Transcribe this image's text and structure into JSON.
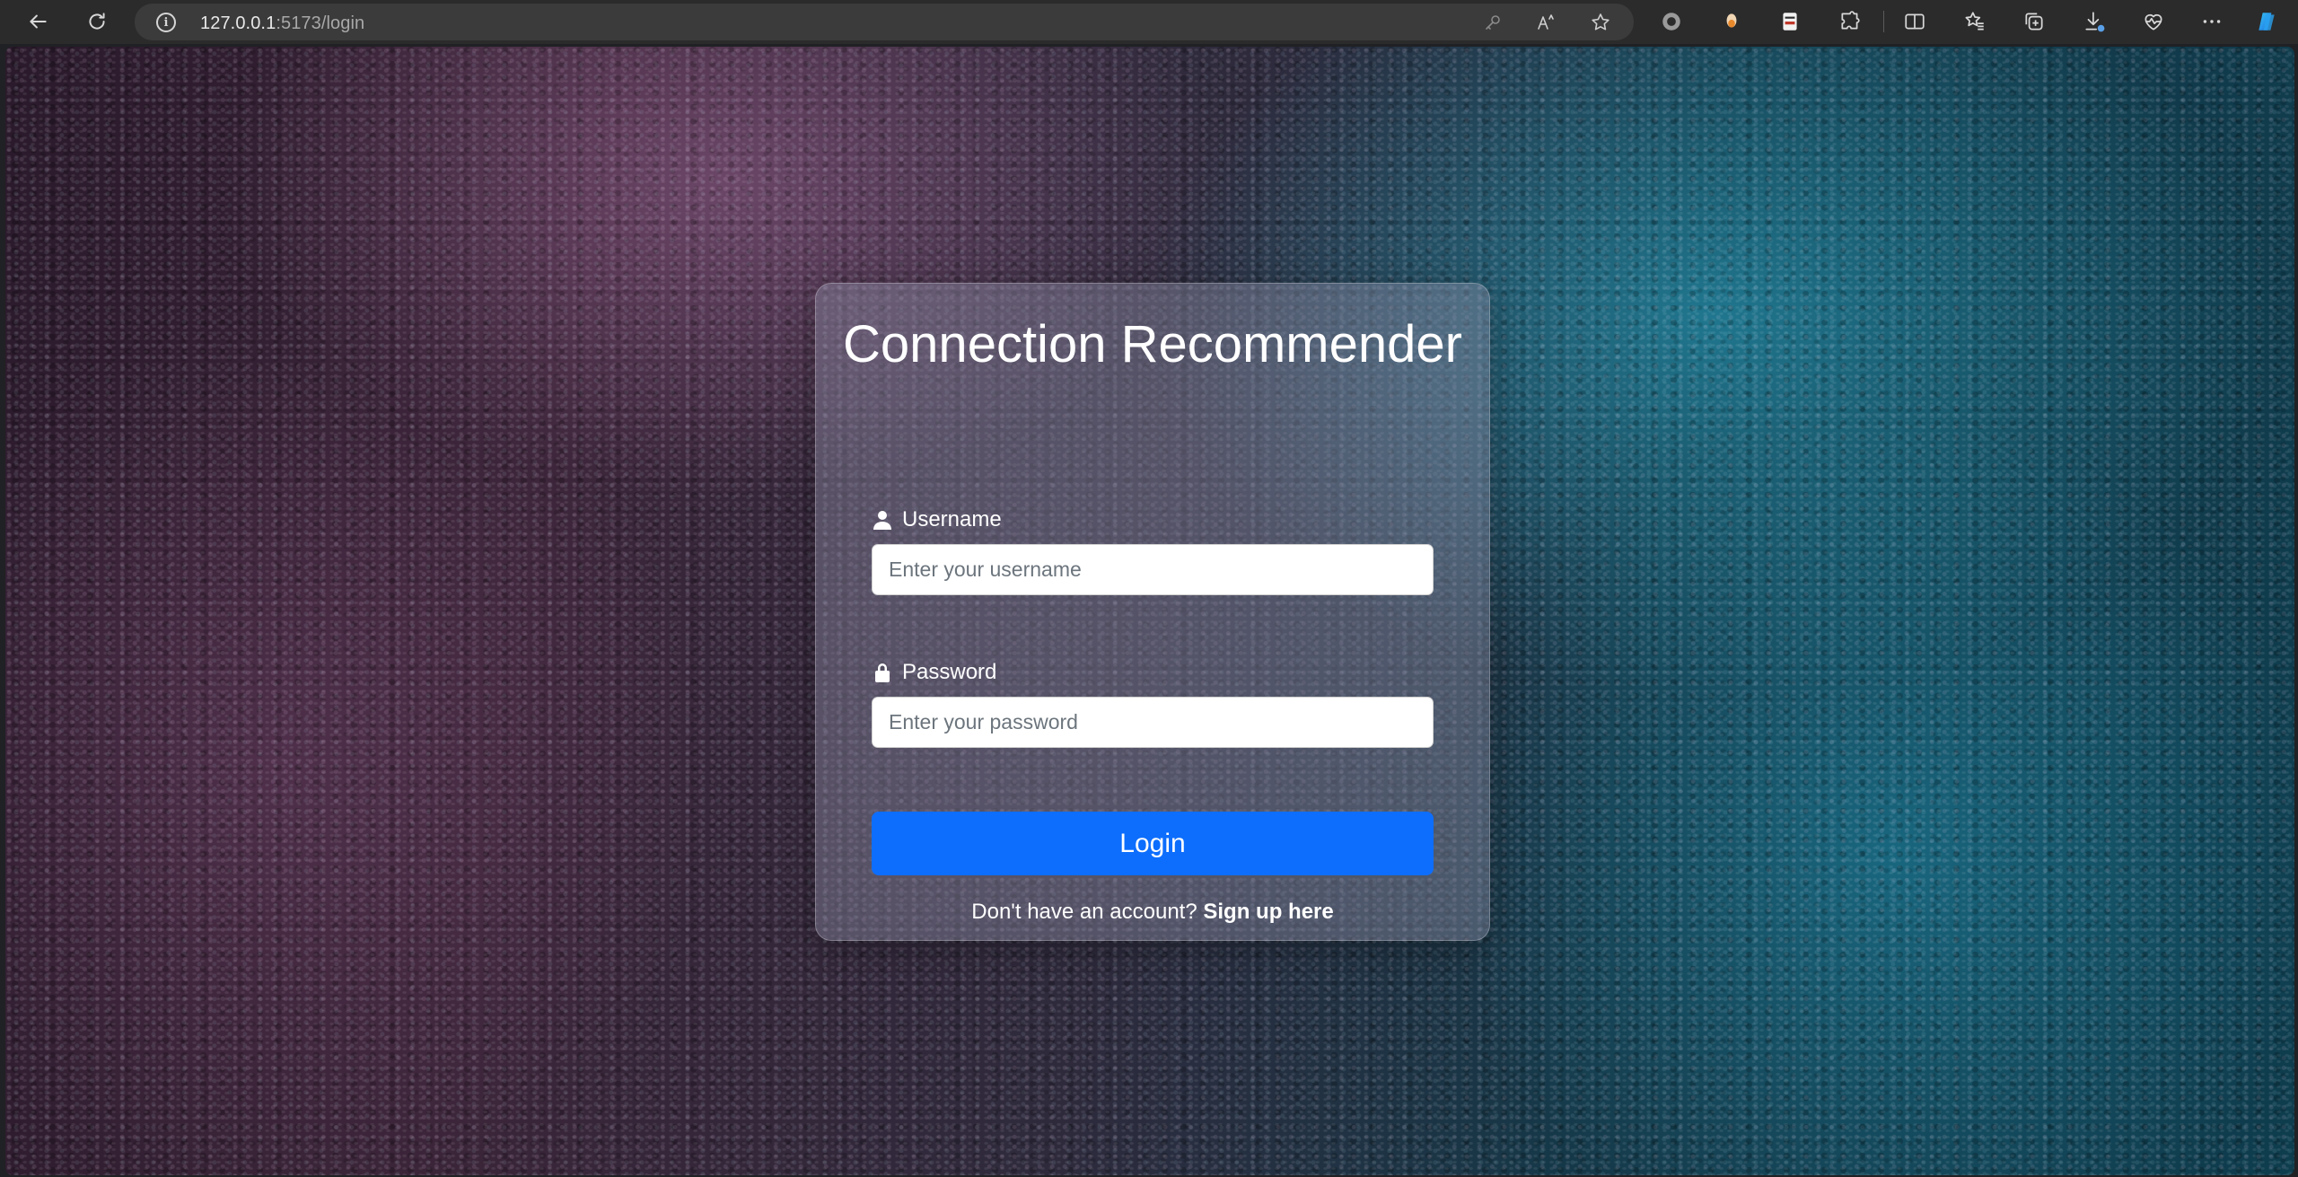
{
  "browser": {
    "url_host": "127.0.0.1",
    "url_rest": ":5173/login",
    "info_icon_glyph": "i",
    "icons": {
      "back": "back-arrow-icon",
      "refresh": "refresh-icon",
      "site_info": "info-icon",
      "password_key": "key-icon",
      "read_aloud": "read-aloud-icon",
      "favorite": "star-icon",
      "extensions": [
        "record-extension-icon",
        "bulb-extension-icon",
        "notes-extension-icon",
        "puzzle-icon"
      ],
      "split_screen": "split-screen-icon",
      "favorites": "favorites-icon",
      "collections": "collections-icon",
      "downloads": "download-icon",
      "browser_essentials": "heart-pulse-icon",
      "more": "more-icon",
      "copilot": "copilot-icon"
    }
  },
  "login": {
    "title": "Connection Recommender",
    "username_label": "Username",
    "username_placeholder": "Enter your username",
    "password_label": "Password",
    "password_placeholder": "Enter your password",
    "login_button": "Login",
    "signup_prompt": "Don't have an account?",
    "signup_link": "Sign up here"
  },
  "colors": {
    "primary_button": "#0d6efd",
    "card_text": "#ffffff",
    "input_placeholder": "#6c757d"
  }
}
